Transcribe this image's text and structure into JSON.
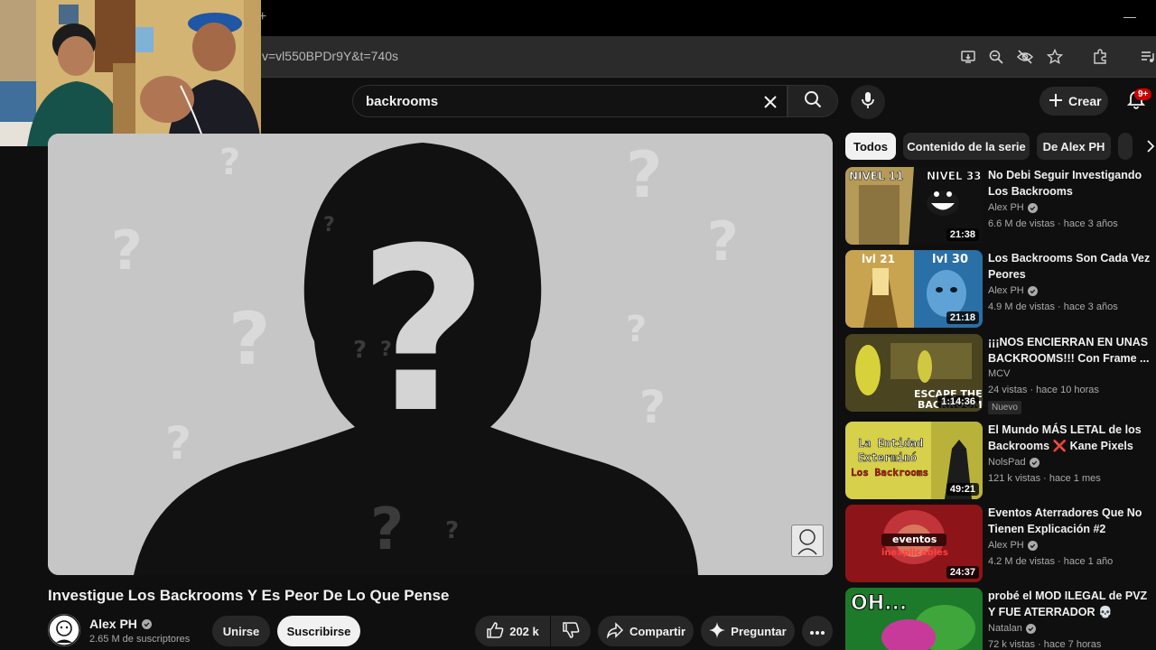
{
  "browser": {
    "new_tab_glyph": "+",
    "minimize_glyph": "—",
    "url": "v=vl550BPDr9Y&t=740s"
  },
  "header": {
    "search_query": "backrooms",
    "create_label": "Crear",
    "notification_count": "9+"
  },
  "video": {
    "title": "Investigue Los Backrooms Y Es Peor De Lo Que Pense",
    "channel": "Alex PH",
    "subscribers": "2.65 M de suscriptores",
    "join_label": "Unirse",
    "subscribe_label": "Suscribirse",
    "likes": "202 k",
    "share_label": "Compartir",
    "ask_label": "Preguntar"
  },
  "chips": [
    "Todos",
    "Contenido de la serie",
    "De Alex PH"
  ],
  "recommendations": [
    {
      "title": "No Debi Seguir Investigando Los Backrooms",
      "channel": "Alex PH",
      "verified": true,
      "meta": "6.6 M de vistas · hace 3 años",
      "duration": "21:38",
      "thumb_labels": [
        "NIVEL 11",
        "NIVEL 33"
      ]
    },
    {
      "title": "Los Backrooms Son Cada Vez Peores",
      "channel": "Alex PH",
      "verified": true,
      "meta": "4.9 M de vistas · hace 3 años",
      "duration": "21:18",
      "thumb_labels": [
        "lvl 21",
        "lvl 30"
      ]
    },
    {
      "title": "¡¡¡NOS ENCIERRAN EN UNAS BACKROOMS!!! Con Frame ...",
      "channel": "MCV",
      "verified": false,
      "meta": "24 vistas · hace 10 horas",
      "duration": "1:14:36",
      "badge": "Nuevo",
      "thumb_labels": [
        "ESCAPE THE",
        "BACKROOMS"
      ]
    },
    {
      "title": "El Mundo MÁS LETAL de los Backrooms ❌ Kane Pixels",
      "channel": "NolsPad",
      "verified": true,
      "meta": "121 k vistas · hace 1 mes",
      "duration": "49:21",
      "thumb_labels": [
        "La Entidad",
        "Exterminó",
        "Los Backrooms"
      ]
    },
    {
      "title": "Eventos Aterradores Que No Tienen Explicación #2",
      "channel": "Alex PH",
      "verified": true,
      "meta": "4.2 M de vistas · hace 1 año",
      "duration": "24:37",
      "thumb_labels": [
        "eventos",
        "inexplicables"
      ]
    },
    {
      "title": "probé el MOD ILEGAL de PVZ Y FUE ATERRADOR 💀",
      "channel": "Natalan",
      "verified": true,
      "meta": "72 k vistas · hace 7 horas",
      "thumb_labels": [
        "OH..."
      ]
    }
  ]
}
